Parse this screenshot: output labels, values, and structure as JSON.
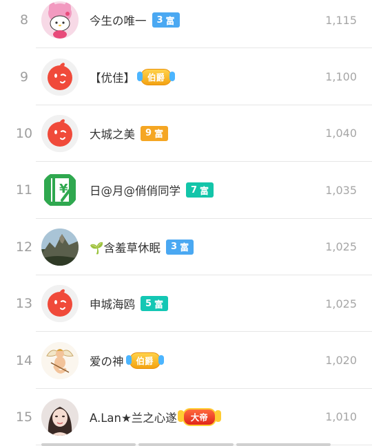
{
  "colors": {
    "rank_text": "#9e9e9e",
    "name_text": "#333333",
    "score_text": "#a6a6a6",
    "divider": "#e6e6e6",
    "badge_blue": "#4aa8f2",
    "badge_orange": "#f5a623",
    "badge_green": "#13c5a9",
    "badge_teal": "#14c7b4"
  },
  "rows": [
    {
      "rank": "8",
      "name": "今生の唯一",
      "badge_type": "level",
      "badge_level": "3",
      "badge_text": "富",
      "badge_color": "#4aa8f2",
      "score": "1,115",
      "avatar": "melody-character-icon"
    },
    {
      "rank": "9",
      "name": "【优佳】",
      "badge_type": "noble",
      "badge_text": "伯爵",
      "score": "1,100",
      "avatar": "default-red-face-icon"
    },
    {
      "rank": "10",
      "name": "大城之美",
      "badge_type": "level",
      "badge_level": "9",
      "badge_text": "富",
      "badge_color": "#f5a623",
      "score": "1,040",
      "avatar": "default-red-face-icon"
    },
    {
      "rank": "11",
      "name": "日@月@俏俏同学",
      "badge_type": "level",
      "badge_level": "7",
      "badge_text": "富",
      "badge_color": "#13c5a9",
      "score": "1,035",
      "avatar": "green-yen-logo-icon"
    },
    {
      "rank": "12",
      "name": "🌱含羞草休眠",
      "badge_type": "level",
      "badge_level": "3",
      "badge_text": "富",
      "badge_color": "#4aa8f2",
      "score": "1,025",
      "avatar": "mountain-photo-icon"
    },
    {
      "rank": "13",
      "name": "申城海鸥",
      "badge_type": "level",
      "badge_level": "5",
      "badge_text": "富",
      "badge_color": "#14c7b4",
      "score": "1,025",
      "avatar": "default-red-face-icon"
    },
    {
      "rank": "14",
      "name": "爱の神",
      "badge_type": "noble",
      "badge_text": "伯爵",
      "score": "1,020",
      "avatar": "cupid-icon"
    },
    {
      "rank": "15",
      "name": "A.Lan★兰之心遂",
      "badge_type": "emperor",
      "badge_text": "大帝",
      "score": "1,010",
      "avatar": "woman-portrait-icon"
    }
  ]
}
